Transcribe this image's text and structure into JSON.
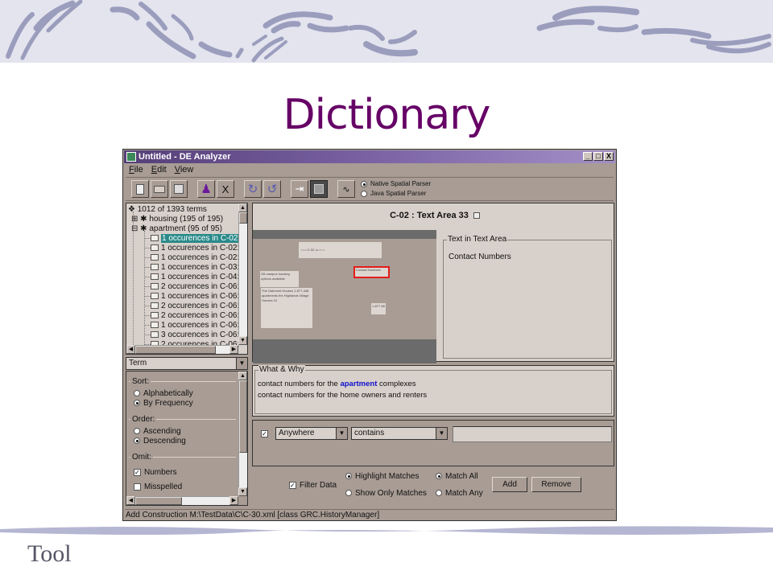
{
  "slide": {
    "title": "Dictionary",
    "footer": "Tool",
    "title_color": "#660066"
  },
  "window": {
    "title": "Untitled - DE Analyzer",
    "controls": [
      "_",
      "□",
      "X"
    ],
    "menu": [
      "File",
      "Edit",
      "View"
    ],
    "toolbar": [
      {
        "name": "new-document",
        "glyph": "🗎"
      },
      {
        "name": "open-folder",
        "glyph": "📂"
      },
      {
        "name": "save-disk",
        "glyph": "💾"
      },
      {
        "name": "add-user",
        "glyph": "♟"
      },
      {
        "name": "delete",
        "glyph": "X"
      },
      {
        "name": "undo",
        "glyph": "↻"
      },
      {
        "name": "redo",
        "glyph": "↺"
      },
      {
        "name": "split-arrow",
        "glyph": "⇥"
      },
      {
        "name": "grid-view",
        "glyph": "▦"
      },
      {
        "name": "waveform",
        "glyph": "∿"
      }
    ],
    "parser_options": [
      {
        "label": "Native Spatial Parser",
        "selected": true
      },
      {
        "label": "Java Spatial Parser",
        "selected": false
      }
    ]
  },
  "tree": {
    "root": "1012 of 1393 terms",
    "nodes": [
      {
        "label": "housing (195 of 195)",
        "expanded": false
      },
      {
        "label": "apartment (95 of 95)",
        "expanded": true
      }
    ],
    "leaves": [
      {
        "label": "1 occurences in C-02:",
        "selected": true
      },
      {
        "label": "1 occurences in C-02:",
        "selected": false
      },
      {
        "label": "1 occurences in C-02:",
        "selected": false
      },
      {
        "label": "1 occurences in C-03:",
        "selected": false
      },
      {
        "label": "1 occurences in C-04:",
        "selected": false
      },
      {
        "label": "2 occurences in C-06:",
        "selected": false
      },
      {
        "label": "1 occurences in C-06:",
        "selected": false
      },
      {
        "label": "2 occurences in C-06:",
        "selected": false
      },
      {
        "label": "2 occurences in C-06:",
        "selected": false
      },
      {
        "label": "1 occurences in C-06:",
        "selected": false
      },
      {
        "label": "3 occurences in C-06:",
        "selected": false
      },
      {
        "label": "2 occurences in C-06:",
        "selected": false
      }
    ],
    "selected_color": "#2a8a8a"
  },
  "term_combo": {
    "value": "Term"
  },
  "options": {
    "sort": {
      "label": "Sort:",
      "items": [
        {
          "label": "Alphabetically",
          "selected": false
        },
        {
          "label": "By Frequency",
          "selected": true
        }
      ]
    },
    "order": {
      "label": "Order:",
      "items": [
        {
          "label": "Ascending",
          "selected": false
        },
        {
          "label": "Descending",
          "selected": true
        }
      ]
    },
    "omit": {
      "label": "Omit:",
      "items": [
        {
          "label": "Numbers",
          "checked": true
        },
        {
          "label": "Misspelled",
          "checked": false
        }
      ]
    }
  },
  "area": {
    "title": "C-02 : Text Area 33",
    "thumbnail_boxes": [
      "• • • C-02 ••• • • •",
      "Contact Numbers",
      "Off-campus housing options available",
      "The Oakmont Houses 1-877-448 apartments the Highlands Village Houses 10",
      "1-877 88"
    ],
    "highlight_color": "#e41c1c",
    "text_panel_label": "Text in Text Area",
    "text_panel_value": "Contact Numbers"
  },
  "what_why": {
    "label": "What & Why",
    "line1_before": "contact numbers for the ",
    "line1_keyword": "apartment",
    "line1_after": " complexes",
    "line2": "contact numbers for the home owners and renters",
    "keyword_color": "#1010cc"
  },
  "filter": {
    "row_checked": true,
    "location": "Anywhere",
    "operator": "contains",
    "value": "",
    "filter_data_label": "Filter Data",
    "filter_data_checked": true,
    "display_modes": [
      {
        "label": "Highlight Matches",
        "selected": true
      },
      {
        "label": "Show Only Matches",
        "selected": false
      }
    ],
    "match_modes": [
      {
        "label": "Match All",
        "selected": true
      },
      {
        "label": "Match Any",
        "selected": false
      }
    ],
    "add_label": "Add",
    "remove_label": "Remove"
  },
  "status": "Add Construction M:\\TestData\\C\\C-30.xml [class GRC.HistoryManager]"
}
